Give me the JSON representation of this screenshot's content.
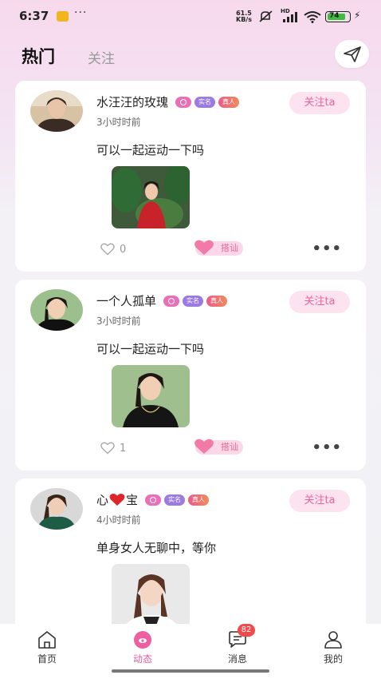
{
  "status_bar": {
    "time": "6:37",
    "more_indicator": "···",
    "net_speed_value": "61.5",
    "net_speed_unit": "KB/s",
    "network_label": "HD",
    "battery_level": "74",
    "icons": [
      "message-notification-icon",
      "mute-icon",
      "signal-icon",
      "wifi-icon",
      "battery-icon",
      "charging-icon"
    ]
  },
  "header": {
    "tab_hot": "热门",
    "tab_follow": "关注",
    "send_icon": "paper-plane-icon"
  },
  "posts": [
    {
      "name": "水汪汪的玫瑰",
      "badge_real": "实名",
      "badge_person": "真人",
      "time": "3小时时前",
      "follow_label": "关注ta",
      "content": "可以一起运动一下吗",
      "likes": "0",
      "chat_label": "搭讪"
    },
    {
      "name": "一个人孤单",
      "badge_real": "实名",
      "badge_person": "真人",
      "time": "3小时时前",
      "follow_label": "关注ta",
      "content": "可以一起运动一下吗",
      "likes": "1",
      "chat_label": "搭讪"
    },
    {
      "name_prefix": "心",
      "name_suffix": "宝",
      "badge_real": "实名",
      "badge_person": "真人",
      "time": "4小时时前",
      "follow_label": "关注ta",
      "content": "单身女人无聊中，等你"
    }
  ],
  "bottom_nav": {
    "home": "首页",
    "feed": "动态",
    "messages": "消息",
    "messages_badge": "82",
    "me": "我的"
  },
  "colors": {
    "accent_pink": "#e55a98",
    "follow_bg": "#fde2ef",
    "badge_purple": "#9b7ae2",
    "unread_red": "#f04a4a"
  }
}
